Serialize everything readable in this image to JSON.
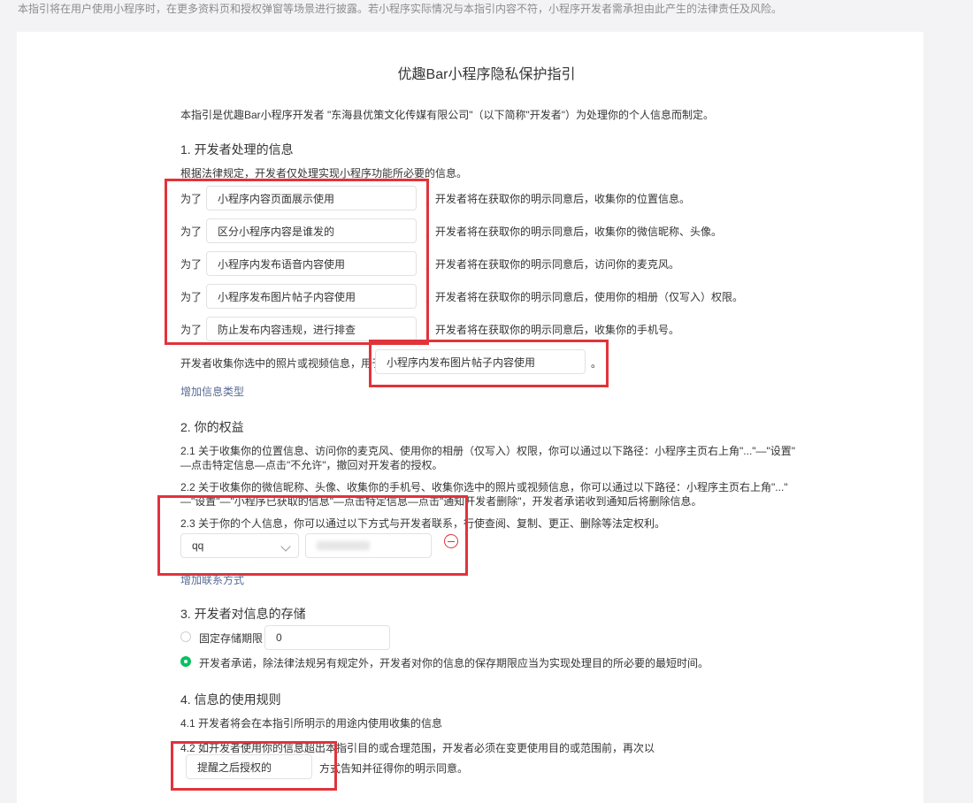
{
  "top_note": "本指引将在用户使用小程序时，在更多资料页和授权弹窗等场景进行披露。若小程序实际情况与本指引内容不符，小程序开发者需承担由此产生的法律责任及风险。",
  "title": "优趣Bar小程序隐私保护指引",
  "intro": "本指引是优趣Bar小程序开发者 \"东海县优策文化传媒有限公司\"（以下简称\"开发者\"）为处理你的个人信息而制定。",
  "section1": {
    "heading": "1. 开发者处理的信息",
    "desc": "根据法律规定，开发者仅处理实现小程序功能所必要的信息。",
    "prefix": "为了",
    "rows": [
      {
        "purpose": "小程序内容页面展示使用",
        "suffix": "，开发者将在获取你的明示同意后，收集你的位置信息。"
      },
      {
        "purpose": "区分小程序内容是谁发的",
        "suffix": "，开发者将在获取你的明示同意后，收集你的微信昵称、头像。"
      },
      {
        "purpose": "小程序内发布语音内容使用",
        "suffix": "，开发者将在获取你的明示同意后，访问你的麦克风。"
      },
      {
        "purpose": "小程序发布图片帖子内容使用",
        "suffix": "，开发者将在获取你的明示同意后，使用你的相册（仅写入）权限。"
      },
      {
        "purpose": "防止发布内容违规，进行排查",
        "suffix": "，开发者将在获取你的明示同意后，收集你的手机号。"
      }
    ],
    "photo_prefix": "开发者收集你选中的照片或视频信息，用于",
    "photo_value": "小程序内发布图片帖子内容使用",
    "photo_suffix": "。",
    "add_link": "增加信息类型"
  },
  "section2": {
    "heading": "2. 你的权益",
    "p21_line1": "2.1  关于收集你的位置信息、访问你的麦克风、使用你的相册（仅写入）权限，你可以通过以下路径：小程序主页右上角\"...\"—\"设置\"",
    "p21_line2": "—点击特定信息—点击\"不允许\"，撤回对开发者的授权。",
    "p22_line1": "2.2  关于收集你的微信昵称、头像、收集你的手机号、收集你选中的照片或视频信息，你可以通过以下路径：小程序主页右上角\"...\"",
    "p22_line2": "—\"设置\"—\"小程序已获取的信息\"—点击特定信息—点击\"通知开发者删除\"，开发者承诺收到通知后将删除信息。",
    "p23": "2.3  关于你的个人信息，你可以通过以下方式与开发者联系，行使查阅、复制、更正、删除等法定权利。",
    "contact_type": "qq",
    "add_contact_link": "增加联系方式"
  },
  "section3": {
    "heading": "3. 开发者对信息的存储",
    "option1_label": "固定存储期限",
    "option1_value": "0",
    "option2_label": "开发者承诺，除法律法规另有规定外，开发者对你的信息的保存期限应当为实现处理目的所必要的最短时间。"
  },
  "section4": {
    "heading": "4. 信息的使用规则",
    "p41": "4.1  开发者将会在本指引所明示的用途内使用收集的信息",
    "p42": "4.2  如开发者使用你的信息超出本指引目的或合理范围，开发者必须在变更使用目的或范围前，再次以",
    "method_value": "提醒之后授权的",
    "method_suffix": "方式告知并征得你的明示同意。"
  }
}
